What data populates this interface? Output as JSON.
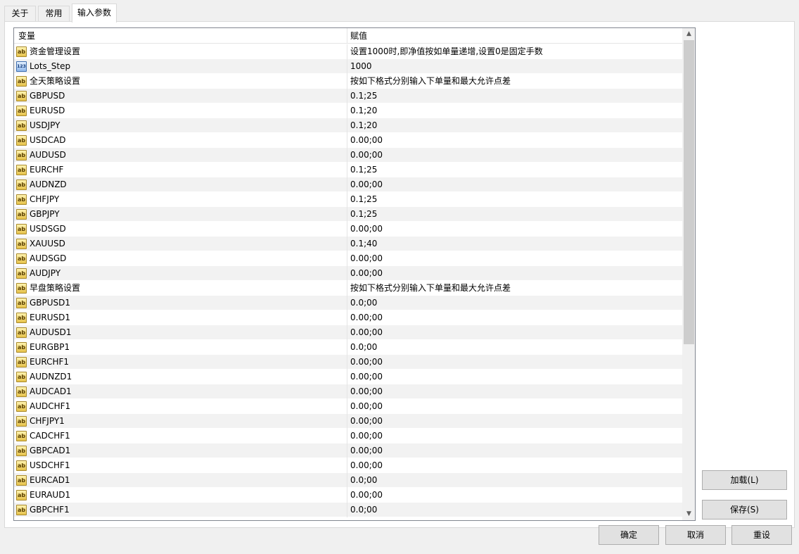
{
  "tabs": [
    {
      "label": "关于"
    },
    {
      "label": "常用"
    },
    {
      "label": "输入参数",
      "active": true
    }
  ],
  "grid": {
    "headers": {
      "variable": "变量",
      "value": "赋值"
    },
    "rows": [
      {
        "type": "ab",
        "name": "资金管理设置",
        "value": "设置1000时,即净值按如单量递增,设置0是固定手数"
      },
      {
        "type": "123",
        "name": "Lots_Step",
        "value": "1000"
      },
      {
        "type": "ab",
        "name": "全天策略设置",
        "value": "按如下格式分别输入下单量和最大允许点差"
      },
      {
        "type": "ab",
        "name": "GBPUSD",
        "value": "0.1;25"
      },
      {
        "type": "ab",
        "name": "EURUSD",
        "value": "0.1;20"
      },
      {
        "type": "ab",
        "name": "USDJPY",
        "value": "0.1;20"
      },
      {
        "type": "ab",
        "name": "USDCAD",
        "value": "0.00;00"
      },
      {
        "type": "ab",
        "name": "AUDUSD",
        "value": "0.00;00"
      },
      {
        "type": "ab",
        "name": "EURCHF",
        "value": "0.1;25"
      },
      {
        "type": "ab",
        "name": "AUDNZD",
        "value": "0.00;00"
      },
      {
        "type": "ab",
        "name": "CHFJPY",
        "value": "0.1;25"
      },
      {
        "type": "ab",
        "name": "GBPJPY",
        "value": "0.1;25"
      },
      {
        "type": "ab",
        "name": "USDSGD",
        "value": "0.00;00"
      },
      {
        "type": "ab",
        "name": "XAUUSD",
        "value": "0.1;40"
      },
      {
        "type": "ab",
        "name": "AUDSGD",
        "value": "0.00;00"
      },
      {
        "type": "ab",
        "name": "AUDJPY",
        "value": "0.00;00"
      },
      {
        "type": "ab",
        "name": "早盘策略设置",
        "value": "按如下格式分别输入下单量和最大允许点差"
      },
      {
        "type": "ab",
        "name": "GBPUSD1",
        "value": "0.0;00"
      },
      {
        "type": "ab",
        "name": "EURUSD1",
        "value": "0.00;00"
      },
      {
        "type": "ab",
        "name": "AUDUSD1",
        "value": "0.00;00"
      },
      {
        "type": "ab",
        "name": "EURGBP1",
        "value": "0.0;00"
      },
      {
        "type": "ab",
        "name": "EURCHF1",
        "value": "0.00;00"
      },
      {
        "type": "ab",
        "name": "AUDNZD1",
        "value": "0.00;00"
      },
      {
        "type": "ab",
        "name": "AUDCAD1",
        "value": "0.00;00"
      },
      {
        "type": "ab",
        "name": "AUDCHF1",
        "value": "0.00;00"
      },
      {
        "type": "ab",
        "name": "CHFJPY1",
        "value": "0.00;00"
      },
      {
        "type": "ab",
        "name": "CADCHF1",
        "value": "0.00;00"
      },
      {
        "type": "ab",
        "name": "GBPCAD1",
        "value": "0.00;00"
      },
      {
        "type": "ab",
        "name": "USDCHF1",
        "value": "0.00;00"
      },
      {
        "type": "ab",
        "name": "EURCAD1",
        "value": "0.0;00"
      },
      {
        "type": "ab",
        "name": "EURAUD1",
        "value": "0.00;00"
      },
      {
        "type": "ab",
        "name": "GBPCHF1",
        "value": "0.0;00"
      }
    ],
    "scroll": {
      "position": 0.0,
      "visible_fraction": 0.65
    }
  },
  "icons": {
    "string": "ab",
    "integer": "123"
  },
  "side_buttons": {
    "load": "加载(L)",
    "save": "保存(S)"
  },
  "bottom_buttons": {
    "ok": "确定",
    "cancel": "取消",
    "reset": "重设"
  }
}
